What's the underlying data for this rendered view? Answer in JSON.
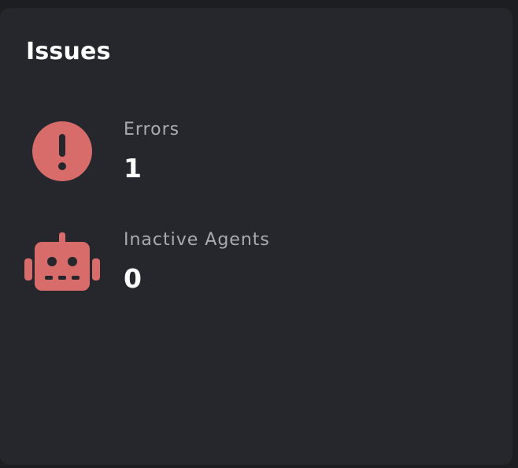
{
  "panel": {
    "title": "Issues"
  },
  "issues": [
    {
      "label": "Errors",
      "value": "1",
      "icon": "exclamation-circle-icon"
    },
    {
      "label": "Inactive Agents",
      "value": "0",
      "icon": "robot-icon"
    }
  ],
  "colors": {
    "background": "#1c1e22",
    "panel": "#25272c",
    "accent": "#d76c6b",
    "title": "#ffffff",
    "label": "#a8abb0"
  }
}
